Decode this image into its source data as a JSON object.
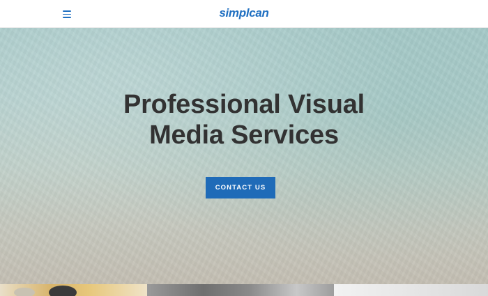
{
  "header": {
    "logo_text": "simplcan",
    "menu_icon": "hamburger-menu-icon"
  },
  "hero": {
    "title_line_1": "Professional Visual",
    "title_line_2": "Media Services",
    "cta_label": "CONTACT US"
  },
  "colors": {
    "brand": "#1f6fc1",
    "cta_background": "#1f6bb8",
    "heading_text": "#323232"
  }
}
